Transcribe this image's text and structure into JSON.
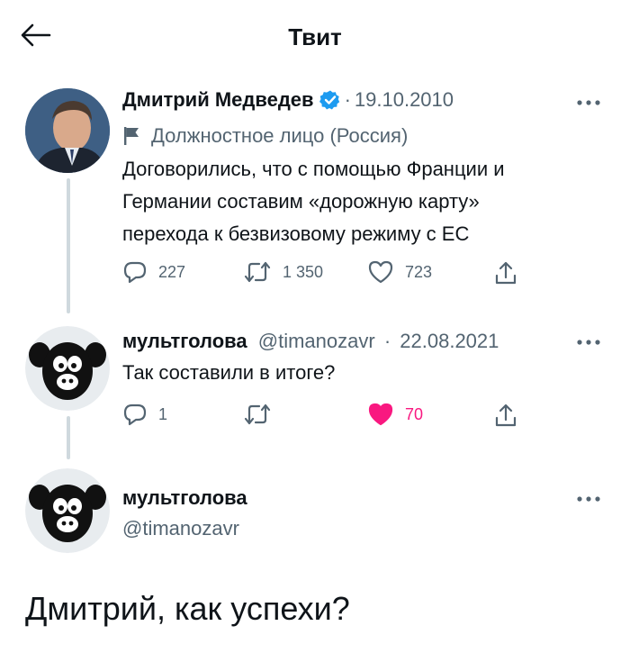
{
  "header": {
    "title": "Твит"
  },
  "tweet1": {
    "name": "Дмитрий Медведев",
    "date": "19.10.2010",
    "affiliation": "Должностное лицо (Россия)",
    "text_lines": [
      "Договорились, что с помощью Франции и",
      "Германии составим «дорожную карту»",
      "перехода к безвизовому режиму с ЕС"
    ],
    "replies": "227",
    "retweets": "1 350",
    "likes": "723"
  },
  "tweet2": {
    "name": "мультголова",
    "handle": "@timanozavr",
    "date": "22.08.2021",
    "text": "Так составили в итоге?",
    "replies": "1",
    "likes": "70"
  },
  "tweet3": {
    "name": "мультголова",
    "handle": "@timanozavr",
    "text": "Дмитрий, как успехи?"
  },
  "colors": {
    "verified": "#1d9bf0",
    "like": "#f91880",
    "secondary": "#536471",
    "thread": "#cfd9de"
  },
  "icons": [
    "back-arrow-icon",
    "verified-badge-icon",
    "more-dots-icon",
    "flag-icon",
    "reply-icon",
    "retweet-icon",
    "like-icon",
    "share-icon"
  ]
}
